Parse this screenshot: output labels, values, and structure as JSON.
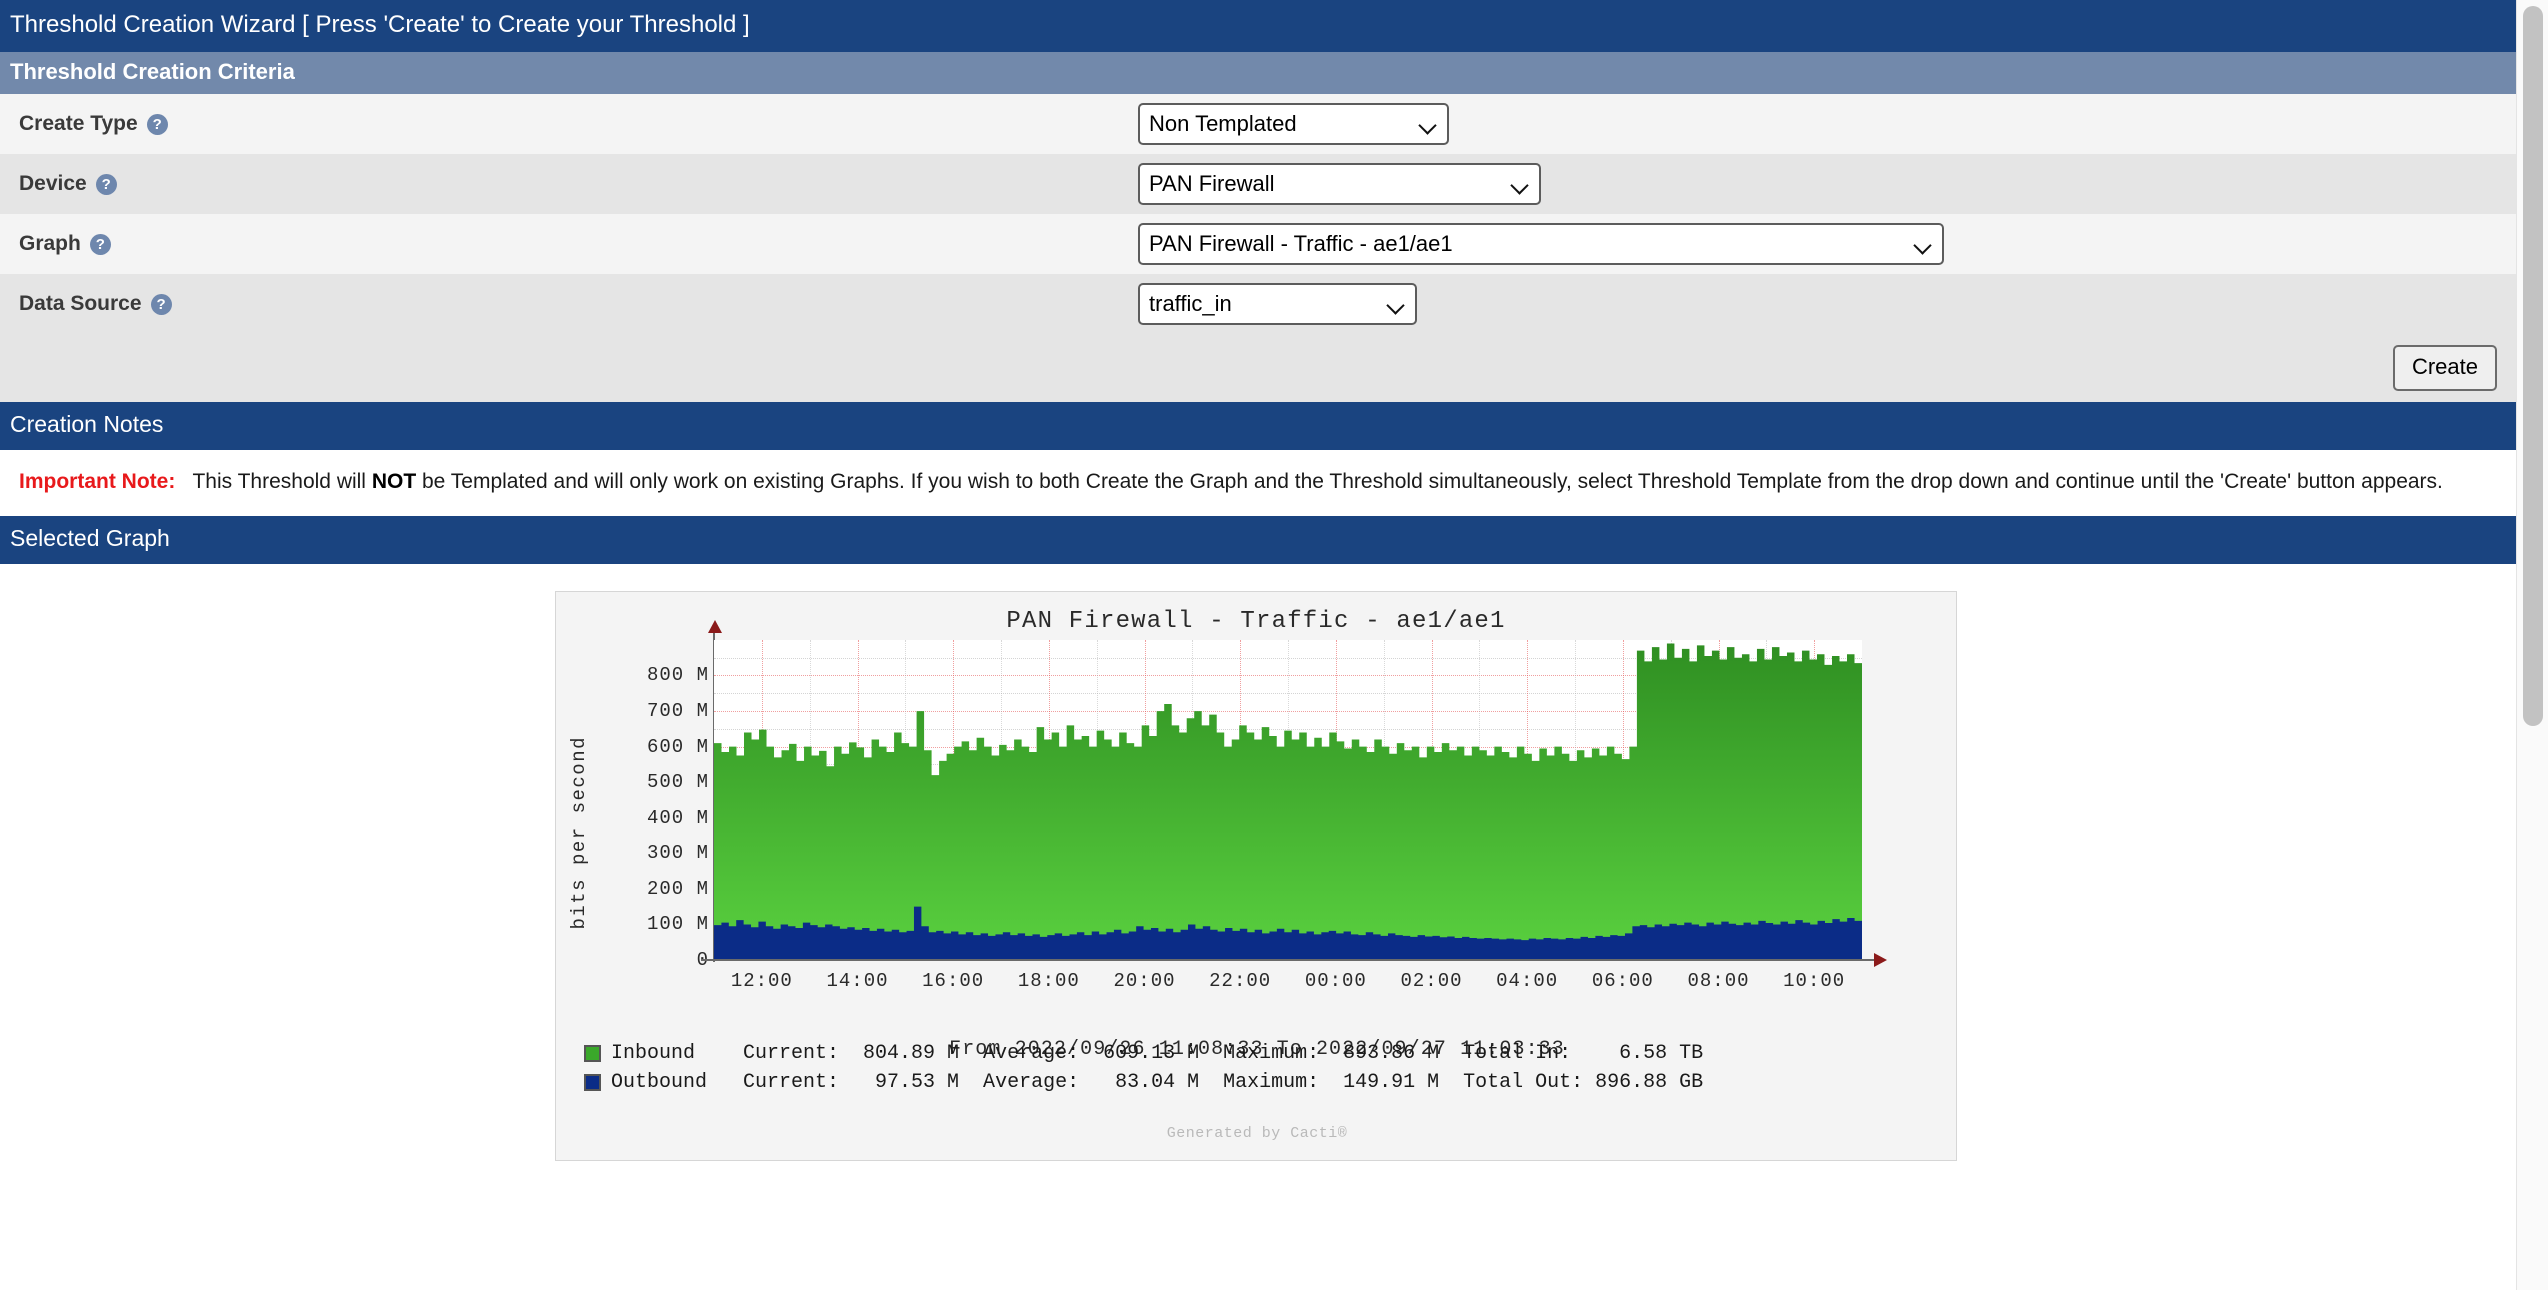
{
  "window": {
    "title": "Threshold Creation Wizard [ Press 'Create' to Create your Threshold ]"
  },
  "criteria": {
    "header": "Threshold Creation Criteria",
    "rows": [
      {
        "label": "Create Type",
        "help": "?",
        "value": "Non Templated"
      },
      {
        "label": "Device",
        "help": "?",
        "value": "PAN Firewall"
      },
      {
        "label": "Graph",
        "help": "?",
        "value": "PAN Firewall - Traffic - ae1/ae1"
      },
      {
        "label": "Data Source",
        "help": "?",
        "value": "traffic_in"
      }
    ],
    "create_button": "Create"
  },
  "notes": {
    "header": "Creation Notes",
    "important_label": "Important Note:",
    "text_before_not": "This Threshold will ",
    "not_word": "NOT",
    "text_after_not": " be Templated and will only work on existing Graphs. If you wish to both Create the Graph and the Threshold simultaneously, select Threshold Template from the drop down and continue until the 'Create' button appears."
  },
  "selected_graph": {
    "header": "Selected Graph",
    "credit": "Generated by Cacti®"
  },
  "chart_data": {
    "type": "area",
    "title": "PAN Firewall - Traffic - ae1/ae1",
    "ylabel": "bits per second",
    "xlabel": "",
    "subtitle": "From 2022/09/26 11:08:33 To 2022/09/27 11:03:33",
    "ylim": [
      0,
      900000000
    ],
    "yticks": [
      "0",
      "100 M",
      "200 M",
      "300 M",
      "400 M",
      "500 M",
      "600 M",
      "700 M",
      "800 M"
    ],
    "ytick_values": [
      0,
      100000000,
      200000000,
      300000000,
      400000000,
      500000000,
      600000000,
      700000000,
      800000000
    ],
    "xticks": [
      "12:00",
      "14:00",
      "16:00",
      "18:00",
      "20:00",
      "22:00",
      "00:00",
      "02:00",
      "04:00",
      "06:00",
      "08:00",
      "10:00"
    ],
    "grid": true,
    "legend_position": "bottom",
    "colors": {
      "inbound": "#3aa82a",
      "outbound": "#0b2c87"
    },
    "series": [
      {
        "name": "Inbound",
        "color": "#3aa82a",
        "current": "804.89 M",
        "average": "609.13 M",
        "maximum": "893.86 M",
        "total_label": "Total In:",
        "total": "6.58 TB",
        "values": [
          610,
          585,
          600,
          575,
          640,
          620,
          648,
          600,
          570,
          590,
          608,
          560,
          600,
          575,
          588,
          545,
          600,
          580,
          612,
          598,
          570,
          620,
          600,
          585,
          640,
          610,
          600,
          700,
          590,
          520,
          560,
          580,
          600,
          615,
          590,
          625,
          600,
          575,
          605,
          590,
          620,
          600,
          585,
          655,
          620,
          640,
          600,
          660,
          620,
          630,
          600,
          645,
          620,
          600,
          640,
          610,
          600,
          660,
          630,
          700,
          720,
          660,
          640,
          680,
          700,
          660,
          690,
          640,
          600,
          620,
          660,
          640,
          620,
          655,
          630,
          600,
          645,
          620,
          640,
          600,
          625,
          600,
          640,
          615,
          595,
          620,
          600,
          585,
          620,
          600,
          580,
          610,
          590,
          600,
          570,
          600,
          585,
          610,
          590,
          600,
          575,
          600,
          590,
          575,
          600,
          585,
          570,
          600,
          580,
          560,
          595,
          575,
          600,
          580,
          560,
          590,
          570,
          595,
          575,
          600,
          580,
          565,
          600,
          870,
          840,
          880,
          845,
          890,
          850,
          875,
          840,
          885,
          855,
          870,
          845,
          880,
          850,
          860,
          840,
          875,
          845,
          880,
          855,
          865,
          840,
          870,
          845,
          860,
          830,
          855,
          840,
          860,
          835,
          855
        ],
        "unit": "M"
      },
      {
        "name": "Outbound",
        "color": "#0b2c87",
        "current": "97.53 M",
        "average": "83.04 M",
        "maximum": "149.91 M",
        "total_label": "Total Out:",
        "total": "896.88 GB",
        "values": [
          98,
          105,
          95,
          112,
          100,
          92,
          108,
          95,
          88,
          100,
          95,
          90,
          105,
          98,
          92,
          100,
          95,
          88,
          92,
          85,
          90,
          82,
          88,
          80,
          85,
          78,
          82,
          150,
          95,
          78,
          82,
          75,
          80,
          72,
          78,
          70,
          75,
          68,
          72,
          78,
          70,
          75,
          68,
          72,
          65,
          70,
          75,
          68,
          72,
          78,
          70,
          80,
          72,
          78,
          85,
          75,
          80,
          95,
          85,
          90,
          80,
          88,
          78,
          85,
          100,
          88,
          95,
          85,
          80,
          90,
          82,
          88,
          78,
          85,
          75,
          80,
          88,
          78,
          85,
          75,
          80,
          72,
          78,
          82,
          75,
          80,
          72,
          70,
          78,
          72,
          68,
          75,
          70,
          68,
          65,
          70,
          66,
          68,
          64,
          66,
          62,
          65,
          62,
          60,
          62,
          60,
          58,
          60,
          58,
          56,
          60,
          58,
          62,
          60,
          58,
          62,
          60,
          65,
          62,
          68,
          65,
          70,
          68,
          75,
          95,
          98,
          92,
          100,
          95,
          102,
          98,
          105,
          100,
          95,
          105,
          100,
          108,
          102,
          98,
          105,
          100,
          110,
          104,
          100,
          108,
          102,
          112,
          105,
          100,
          110,
          104,
          115,
          108,
          118,
          110,
          120
        ],
        "unit": "M"
      }
    ],
    "legend_labels": {
      "current": "Current:",
      "average": "Average:",
      "maximum": "Maximum:"
    }
  }
}
